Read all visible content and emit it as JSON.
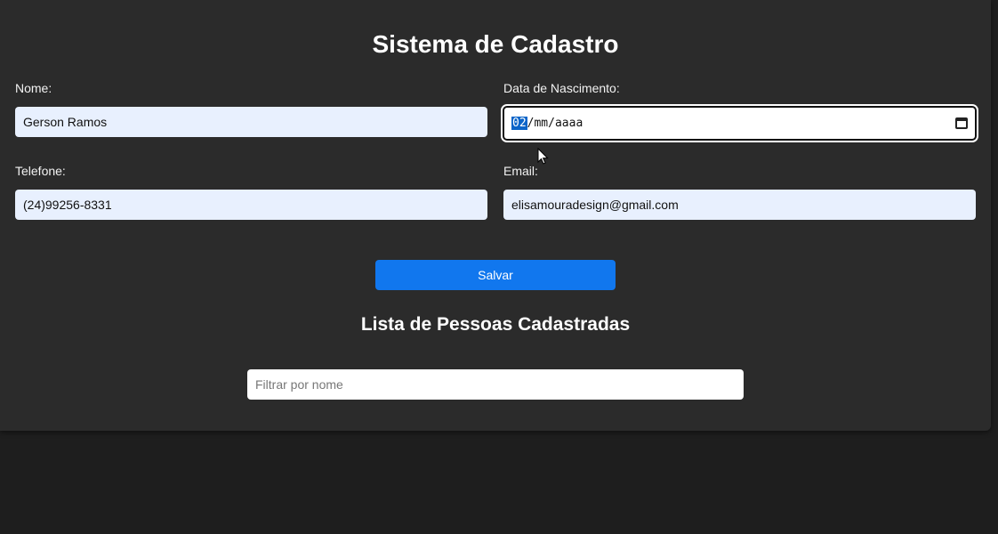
{
  "form": {
    "title": "Sistema de Cadastro",
    "nome_label": "Nome:",
    "nome_value": "Gerson Ramos",
    "nascimento_label": "Data de Nascimento:",
    "nascimento_day": "02",
    "nascimento_sep1": "/",
    "nascimento_month": "mm",
    "nascimento_sep2": "/",
    "nascimento_year": "aaaa",
    "telefone_label": "Telefone:",
    "telefone_value": "(24)99256-8331",
    "email_label": "Email:",
    "email_value": "elisamouradesign@gmail.com",
    "save_label": "Salvar"
  },
  "list": {
    "title": "Lista de Pessoas Cadastradas",
    "filter_placeholder": "Filtrar por nome"
  },
  "colors": {
    "background": "#1e1e1e",
    "panel": "#2b2b2b",
    "accent": "#1177ee",
    "autofill": "#e8f0fe"
  },
  "icons": {
    "calendar": "calendar-icon",
    "cursor": "mouse-cursor-icon"
  }
}
